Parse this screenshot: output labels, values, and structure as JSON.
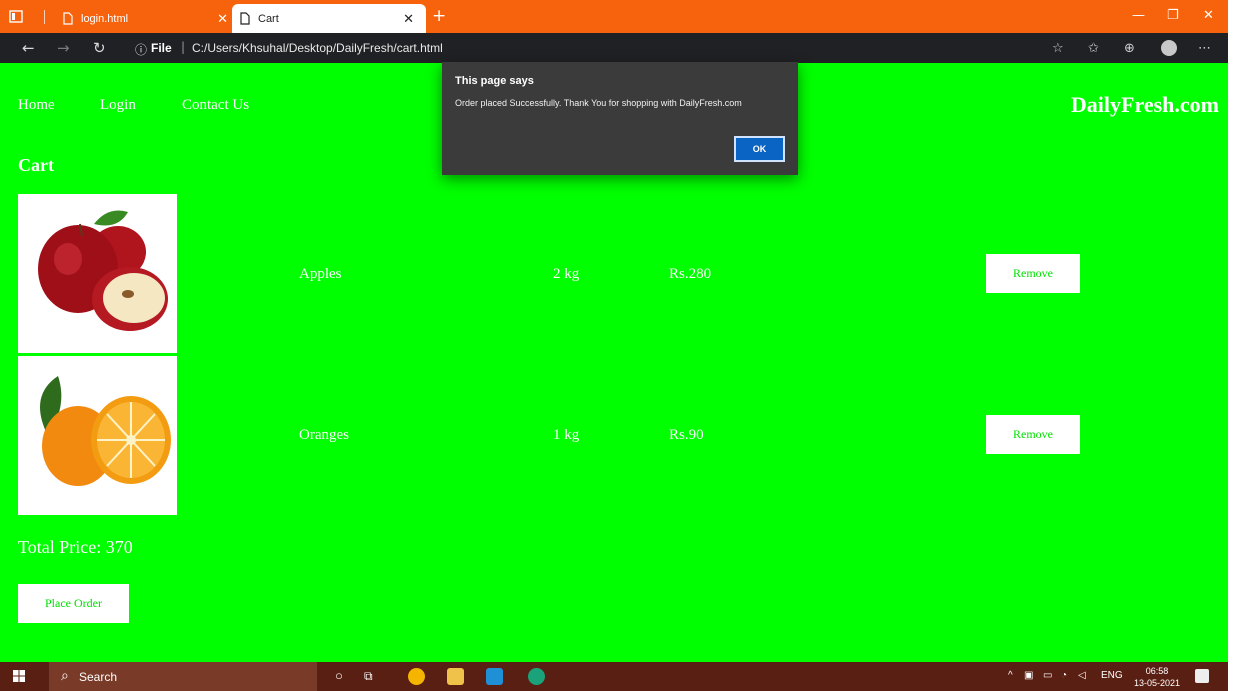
{
  "browser": {
    "tabs": [
      {
        "title": "login.html"
      },
      {
        "title": "Cart"
      }
    ],
    "address": {
      "file_label": "File",
      "url": "C:/Users/Khsuhal/Desktop/DailyFresh/cart.html"
    }
  },
  "page": {
    "nav": [
      "Home",
      "Login",
      "Contact Us"
    ],
    "brand": "DailyFresh.com",
    "cart_title": "Cart",
    "items": [
      {
        "name": "Apples",
        "qty": "2 kg",
        "price": "Rs.280",
        "remove_label": "Remove",
        "image": "apples-image"
      },
      {
        "name": "Oranges",
        "qty": "1 kg",
        "price": "Rs.90",
        "remove_label": "Remove",
        "image": "oranges-image"
      }
    ],
    "total": "Total Price: 370",
    "place_order_label": "Place Order",
    "background_color": "#00ff00"
  },
  "dialog": {
    "title": "This page says",
    "message": "Order placed Successfully. Thank You for shopping with DailyFresh.com",
    "ok_label": "OK"
  },
  "taskbar": {
    "search_label": "Search",
    "lang": "ENG",
    "time": "06:58",
    "date": "13-05-2021"
  }
}
